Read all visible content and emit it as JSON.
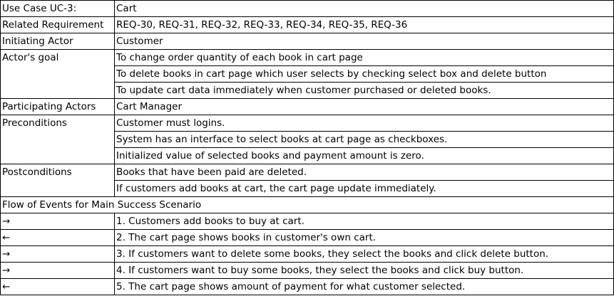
{
  "header": {
    "label": "Use Case UC-3:",
    "value": "Cart"
  },
  "related_requirement": {
    "label": "Related Requirement",
    "value": "REQ-30, REQ-31, REQ-32, REQ-33, REQ-34, REQ-35, REQ-36"
  },
  "initiating_actor": {
    "label": "Initiating Actor",
    "value": "Customer"
  },
  "actors_goal": {
    "label": "Actor's goal",
    "items": [
      "To change order quantity of each book in cart page",
      "To delete books in cart page which user selects by checking select box and delete button",
      "To update cart data immediately when customer purchased or deleted books."
    ]
  },
  "participating_actors": {
    "label": "Participating Actors",
    "value": "Cart Manager"
  },
  "preconditions": {
    "label": "Preconditions",
    "items": [
      "Customer must logins.",
      "System has an interface to select books at cart page as checkboxes.",
      "Initialized value of selected books and payment amount is zero."
    ]
  },
  "postconditions": {
    "label": "Postconditions",
    "items": [
      "Books that have been paid are deleted.",
      "If customers add books at cart, the cart page update immediately."
    ]
  },
  "flow": {
    "title": "Flow of Events for Main Success Scenario",
    "steps": [
      {
        "arrow": "→",
        "text": "1. Customers add books to buy at cart."
      },
      {
        "arrow": "←",
        "text": "2. The cart page shows books in customer's own cart."
      },
      {
        "arrow": "→",
        "text": "3. If customers want to delete some books, they select the books and click delete button."
      },
      {
        "arrow": "→",
        "text": "4. If customers want to buy some books, they select the books and click buy button."
      },
      {
        "arrow": "←",
        "text": "5. The cart page shows amount of payment for what customer selected."
      }
    ]
  }
}
